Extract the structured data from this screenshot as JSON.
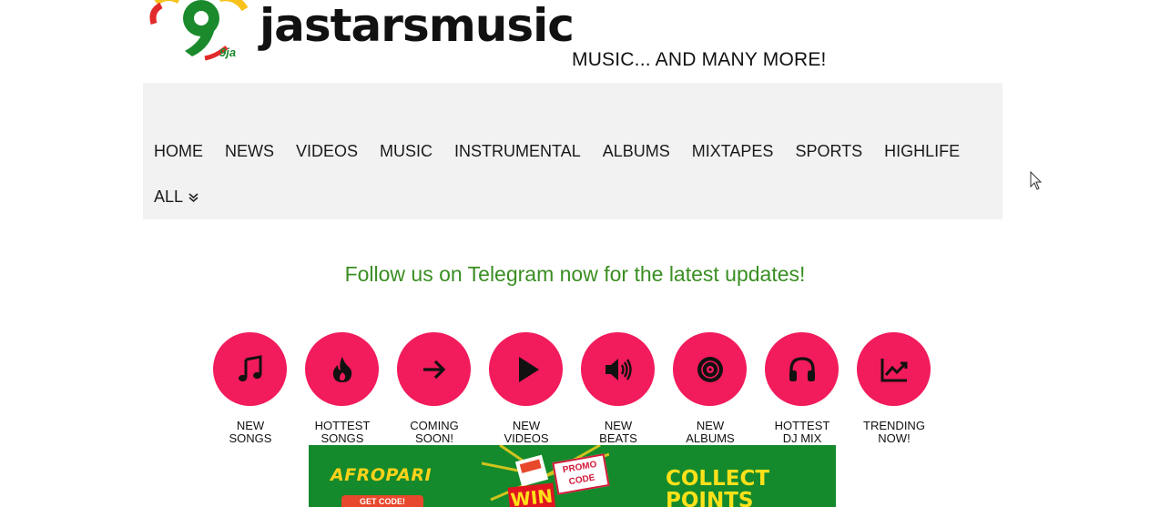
{
  "site": {
    "logo_mark_text": "9ja",
    "name": "jastarsmusic",
    "tagline": "MUSIC... AND MANY MORE!"
  },
  "nav": {
    "items": [
      "HOME",
      "NEWS",
      "VIDEOS",
      "MUSIC",
      "INSTRUMENTAL",
      "ALBUMS",
      "MIXTAPES",
      "SPORTS",
      "HIGHLIFE"
    ],
    "all_label": "ALL",
    "all_icon": "double-chevron-down-icon"
  },
  "telegram_text": "Follow us on Telegram now for the latest updates!",
  "categories": [
    {
      "line1": "NEW",
      "line2": "SONGS",
      "icon": "music-note-icon"
    },
    {
      "line1": "HOTTEST",
      "line2": "SONGS",
      "icon": "fire-icon"
    },
    {
      "line1": "COMING",
      "line2": "SOON!",
      "icon": "arrow-right-icon"
    },
    {
      "line1": "NEW",
      "line2": "VIDEOS",
      "icon": "play-icon"
    },
    {
      "line1": "NEW",
      "line2": "BEATS",
      "icon": "speaker-icon"
    },
    {
      "line1": "NEW",
      "line2": "ALBUMS",
      "icon": "record-icon"
    },
    {
      "line1": "HOTTEST",
      "line2": "DJ MIX",
      "icon": "headphones-icon"
    },
    {
      "line1": "TRENDING",
      "line2": "NOW!",
      "icon": "chart-icon"
    }
  ],
  "banner": {
    "brand": "AFROPARI",
    "get_code": "GET CODE!",
    "promo": "PROMO CODE",
    "win": "WIN",
    "headline_line1": "COLLECT",
    "headline_line2": "POINTS"
  },
  "colors": {
    "accent_pink": "#f21b5b",
    "telegram_green": "#3a8e22",
    "banner_green": "#148a2c",
    "banner_yellow": "#ffe11a",
    "nav_bg": "#f2f2f2"
  }
}
